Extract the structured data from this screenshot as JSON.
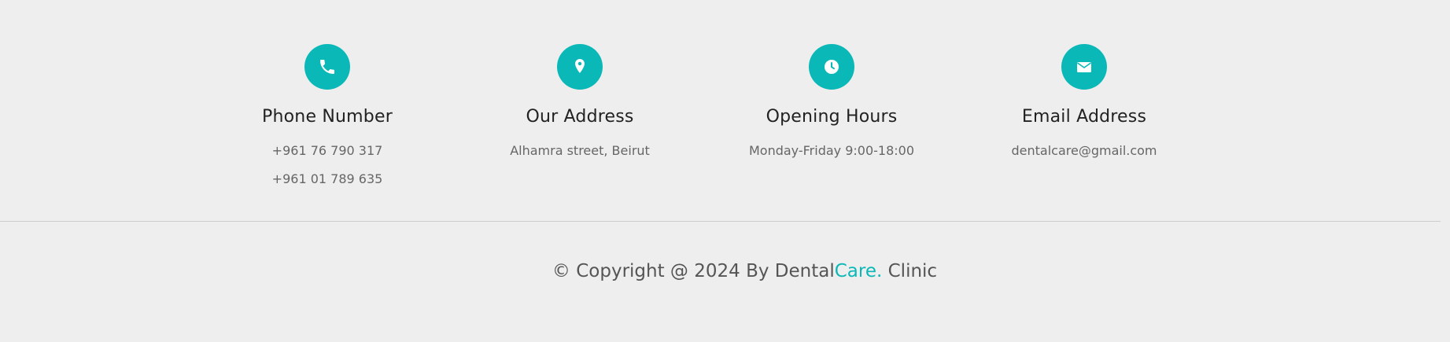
{
  "colors": {
    "accent": "#0ab8b7",
    "background": "#eeeeee",
    "title_text": "#222222",
    "body_text": "#666666"
  },
  "contacts": [
    {
      "icon": "phone-icon",
      "title": "Phone Number",
      "lines": [
        "+961 76 790 317",
        "+961 01 789 635"
      ]
    },
    {
      "icon": "location-pin-icon",
      "title": "Our Address",
      "lines": [
        "Alhamra street, Beirut"
      ]
    },
    {
      "icon": "clock-icon",
      "title": "Opening Hours",
      "lines": [
        "Monday-Friday 9:00-18:00"
      ]
    },
    {
      "icon": "envelope-icon",
      "title": "Email Address",
      "lines": [
        "dentalcare@gmail.com"
      ]
    }
  ],
  "copyright": {
    "prefix": "© Copyright @ 2024 By Dental",
    "brand_accent": "Care.",
    "suffix": " Clinic"
  }
}
